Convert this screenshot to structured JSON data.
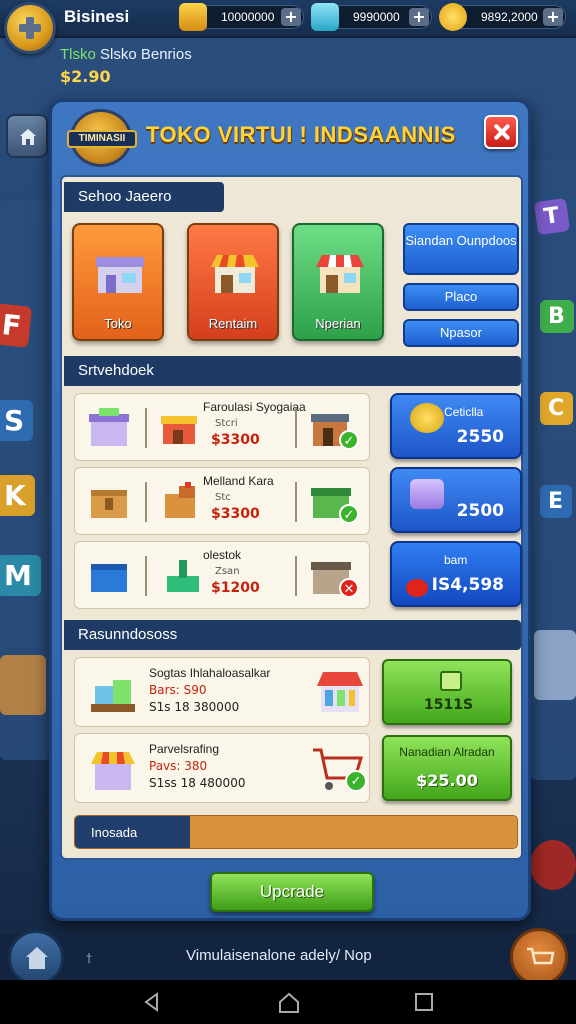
{
  "topbar": {
    "app_name": "Bisinesi",
    "resources": [
      {
        "icon": "gold-coins-icon",
        "value": "10000000"
      },
      {
        "icon": "gem-cube-icon",
        "value": "9990000"
      },
      {
        "icon": "coin-icon",
        "value": "9892,2000"
      }
    ]
  },
  "store": {
    "label_green": "Tlsko",
    "label_rest": " Slsko Benrios",
    "money": "$2.90"
  },
  "dialog": {
    "badge": "TIMINASII",
    "title": "TOKO VIRTUI ! INDSAANNIS",
    "section1": "Sehoo Jaeero",
    "categories": [
      {
        "label": "Toko",
        "color": "#f07a1e"
      },
      {
        "label": "Rentaim",
        "color": "#e8542a"
      },
      {
        "label": "Nperian",
        "color": "#4fc36a"
      }
    ],
    "side_buttons": [
      "Siandan Ounpdoos",
      "Placo",
      "Npasor"
    ],
    "section2": "Srtvehdoek",
    "products": [
      {
        "name": "Faroulasi Syogaiaa",
        "sub": "Stcri",
        "price": "$3300",
        "status": "ok"
      },
      {
        "name": "Melland Kara",
        "sub": "Stc",
        "price": "$3300",
        "status": "ok"
      },
      {
        "name": "olestok",
        "sub": "Zsan",
        "price": "$1200",
        "status": "x"
      }
    ],
    "buy_buttons": [
      {
        "top": "Ceticlla",
        "amount": "2550"
      },
      {
        "top": "",
        "amount": "2500"
      },
      {
        "top": "bam",
        "amount": "IS4,598"
      }
    ],
    "section3": "Rasunndososs",
    "upgrades": [
      {
        "name": "Sogtas Ihlahaloasalkar",
        "line2": "Bars: S90",
        "line3": "S1s 18 380000"
      },
      {
        "name": "Parvelsrafing",
        "line2": "Pavs: 380",
        "line3": "S1ss 18 480000"
      }
    ],
    "green_buttons": [
      {
        "top": "",
        "amount": "1511S"
      },
      {
        "top": "Nanadian Alradan",
        "amount": "$25.00"
      }
    ],
    "progress_label": "Inosada",
    "progress_value": 0.26,
    "upgrade_button": "Upcrade"
  },
  "bottom": {
    "caption": "Vimulaisenalone adely/ Nop",
    "tiny": "†"
  },
  "colors": {
    "title": "#ffd43a",
    "price": "#c4230e",
    "accent_blue": "#1e56c8",
    "accent_green": "#44a71c"
  }
}
